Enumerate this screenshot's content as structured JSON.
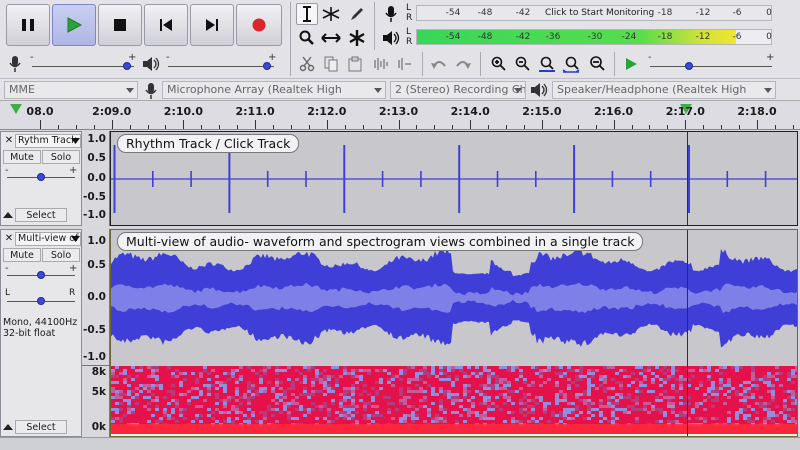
{
  "transport": {
    "pause": "pause-icon",
    "play": "play-icon",
    "stop": "stop-icon",
    "skip_start": "skip-to-start-icon",
    "skip_end": "skip-to-end-icon",
    "record": "record-icon"
  },
  "meters": {
    "record_ticks": [
      "-54",
      "-48",
      "-42",
      "-18",
      "-12",
      "-6",
      "0"
    ],
    "record_prompt": "Click to Start Monitoring",
    "play_ticks": [
      "-54",
      "-48",
      "-42",
      "-36",
      "-30",
      "-24",
      "-18",
      "-12",
      "-6",
      "0"
    ],
    "play_level_pct": 90,
    "left": "L",
    "right": "R"
  },
  "mixer": {
    "minus": "-",
    "plus": "+"
  },
  "devices": {
    "host": "MME",
    "input": "Microphone Array (Realtek High",
    "channels": "2 (Stereo) Recording Cha",
    "output": "Speaker/Headphone (Realtek High"
  },
  "ruler": {
    "labels": [
      "08.0",
      "2:09.0",
      "2:10.0",
      "2:11.0",
      "2:12.0",
      "2:13.0",
      "2:14.0",
      "2:15.0",
      "2:16.0",
      "2:17.0",
      "2:18.0"
    ]
  },
  "tracks": [
    {
      "name": "Rythm Track",
      "mute": "Mute",
      "solo": "Solo",
      "select": "Select",
      "clip_label": "Rhythm Track / Click Track",
      "scale": [
        "1.0",
        "0.5",
        "0.0",
        "-0.5",
        "-1.0"
      ]
    },
    {
      "name": "Multi-view of",
      "mute": "Mute",
      "solo": "Solo",
      "select": "Select",
      "pan_left": "L",
      "pan_right": "R",
      "info": [
        "Mono, 44100Hz",
        "32-bit float"
      ],
      "clip_label": "Multi-view of audio- waveform and spectrogram views combined in a single track",
      "scale": [
        "1.0",
        "0.5",
        "0.0",
        "-0.5",
        "-1.0"
      ],
      "spec_scale": [
        "8k",
        "5k",
        "0k"
      ]
    }
  ],
  "colors": {
    "waveform": "#3f3fd8",
    "meter_green": "#37d75a",
    "playhead": "#3fae46",
    "record": "#d9262a"
  }
}
